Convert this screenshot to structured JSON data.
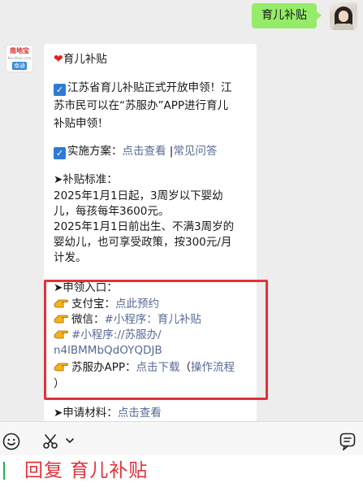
{
  "outgoing": {
    "text": "育儿补贴"
  },
  "official_account": {
    "logo_text": "南地宝",
    "logo_domain": "Nandibao.com",
    "logo_city": "南通"
  },
  "message": {
    "title": "育儿补贴",
    "intro_1": "江苏省育儿补贴正式开放申领！江",
    "intro_2": "苏市民可以在“苏服办”APP进行育儿",
    "intro_3": "补贴申领！",
    "plan_label": "实施方案：",
    "plan_link_1": "点击查看",
    "plan_sep": " |",
    "plan_link_2": "常见问答",
    "standard_title": "➤补贴标准：",
    "standard_1": "2025年1月1日起，3周岁以下婴幼",
    "standard_2": "儿，每孩每年3600元。",
    "standard_3": "2025年1月1日前出生、不满3周岁的",
    "standard_4": "婴幼儿，也可享受政策，按300元/月",
    "standard_5": "计发。",
    "entry_title": "➤申领入口：",
    "alipay_label": "支付宝：",
    "alipay_link": "点此预约",
    "wechat_label": "微信：",
    "wechat_link": "#小程序：育儿补贴",
    "mini_link_1": "#小程序://苏服办/",
    "mini_link_2": "n4lBMMbQdOYQDJB",
    "sfb_label": "苏服办APP：",
    "sfb_link": "点击下载",
    "sfb_open": "（",
    "sfb_flow_link": "操作流程",
    "sfb_close": "）",
    "materials_title": "➤申请材料：",
    "materials_link": "点击查看"
  },
  "caption": {
    "text": "回复 育儿补贴"
  },
  "colors": {
    "link": "#576b95",
    "highlight": "#e0323a",
    "bubble_out": "#95ec69",
    "caption": "#e0323a"
  },
  "icons": [
    "emoji-icon",
    "scissors-icon",
    "chevron-down-icon",
    "keyboard-toggle-icon"
  ]
}
